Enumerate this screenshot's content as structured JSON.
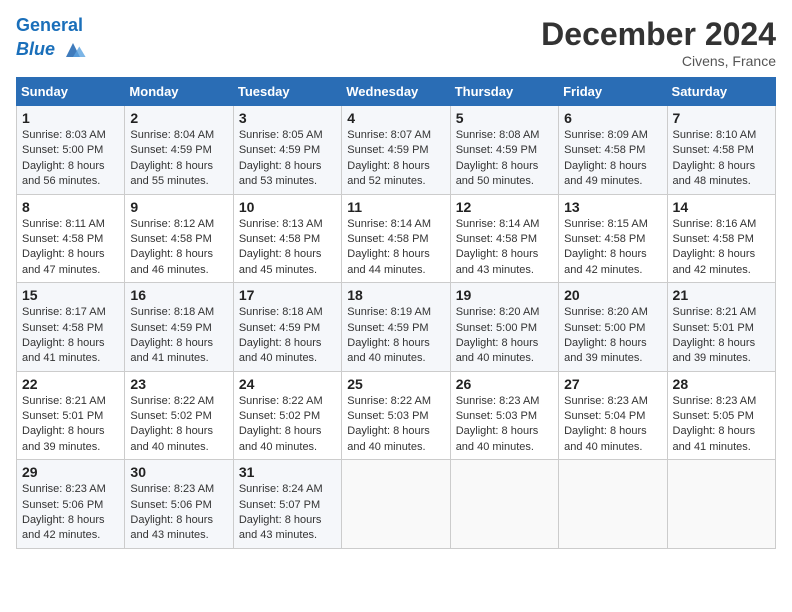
{
  "header": {
    "logo_line1": "General",
    "logo_line2": "Blue",
    "month_title": "December 2024",
    "location": "Civens, France"
  },
  "days_of_week": [
    "Sunday",
    "Monday",
    "Tuesday",
    "Wednesday",
    "Thursday",
    "Friday",
    "Saturday"
  ],
  "weeks": [
    [
      {
        "day": "1",
        "sunrise": "8:03 AM",
        "sunset": "5:00 PM",
        "daylight": "8 hours and 56 minutes."
      },
      {
        "day": "2",
        "sunrise": "8:04 AM",
        "sunset": "4:59 PM",
        "daylight": "8 hours and 55 minutes."
      },
      {
        "day": "3",
        "sunrise": "8:05 AM",
        "sunset": "4:59 PM",
        "daylight": "8 hours and 53 minutes."
      },
      {
        "day": "4",
        "sunrise": "8:07 AM",
        "sunset": "4:59 PM",
        "daylight": "8 hours and 52 minutes."
      },
      {
        "day": "5",
        "sunrise": "8:08 AM",
        "sunset": "4:59 PM",
        "daylight": "8 hours and 50 minutes."
      },
      {
        "day": "6",
        "sunrise": "8:09 AM",
        "sunset": "4:58 PM",
        "daylight": "8 hours and 49 minutes."
      },
      {
        "day": "7",
        "sunrise": "8:10 AM",
        "sunset": "4:58 PM",
        "daylight": "8 hours and 48 minutes."
      }
    ],
    [
      {
        "day": "8",
        "sunrise": "8:11 AM",
        "sunset": "4:58 PM",
        "daylight": "8 hours and 47 minutes."
      },
      {
        "day": "9",
        "sunrise": "8:12 AM",
        "sunset": "4:58 PM",
        "daylight": "8 hours and 46 minutes."
      },
      {
        "day": "10",
        "sunrise": "8:13 AM",
        "sunset": "4:58 PM",
        "daylight": "8 hours and 45 minutes."
      },
      {
        "day": "11",
        "sunrise": "8:14 AM",
        "sunset": "4:58 PM",
        "daylight": "8 hours and 44 minutes."
      },
      {
        "day": "12",
        "sunrise": "8:14 AM",
        "sunset": "4:58 PM",
        "daylight": "8 hours and 43 minutes."
      },
      {
        "day": "13",
        "sunrise": "8:15 AM",
        "sunset": "4:58 PM",
        "daylight": "8 hours and 42 minutes."
      },
      {
        "day": "14",
        "sunrise": "8:16 AM",
        "sunset": "4:58 PM",
        "daylight": "8 hours and 42 minutes."
      }
    ],
    [
      {
        "day": "15",
        "sunrise": "8:17 AM",
        "sunset": "4:58 PM",
        "daylight": "8 hours and 41 minutes."
      },
      {
        "day": "16",
        "sunrise": "8:18 AM",
        "sunset": "4:59 PM",
        "daylight": "8 hours and 41 minutes."
      },
      {
        "day": "17",
        "sunrise": "8:18 AM",
        "sunset": "4:59 PM",
        "daylight": "8 hours and 40 minutes."
      },
      {
        "day": "18",
        "sunrise": "8:19 AM",
        "sunset": "4:59 PM",
        "daylight": "8 hours and 40 minutes."
      },
      {
        "day": "19",
        "sunrise": "8:20 AM",
        "sunset": "5:00 PM",
        "daylight": "8 hours and 40 minutes."
      },
      {
        "day": "20",
        "sunrise": "8:20 AM",
        "sunset": "5:00 PM",
        "daylight": "8 hours and 39 minutes."
      },
      {
        "day": "21",
        "sunrise": "8:21 AM",
        "sunset": "5:01 PM",
        "daylight": "8 hours and 39 minutes."
      }
    ],
    [
      {
        "day": "22",
        "sunrise": "8:21 AM",
        "sunset": "5:01 PM",
        "daylight": "8 hours and 39 minutes."
      },
      {
        "day": "23",
        "sunrise": "8:22 AM",
        "sunset": "5:02 PM",
        "daylight": "8 hours and 40 minutes."
      },
      {
        "day": "24",
        "sunrise": "8:22 AM",
        "sunset": "5:02 PM",
        "daylight": "8 hours and 40 minutes."
      },
      {
        "day": "25",
        "sunrise": "8:22 AM",
        "sunset": "5:03 PM",
        "daylight": "8 hours and 40 minutes."
      },
      {
        "day": "26",
        "sunrise": "8:23 AM",
        "sunset": "5:03 PM",
        "daylight": "8 hours and 40 minutes."
      },
      {
        "day": "27",
        "sunrise": "8:23 AM",
        "sunset": "5:04 PM",
        "daylight": "8 hours and 40 minutes."
      },
      {
        "day": "28",
        "sunrise": "8:23 AM",
        "sunset": "5:05 PM",
        "daylight": "8 hours and 41 minutes."
      }
    ],
    [
      {
        "day": "29",
        "sunrise": "8:23 AM",
        "sunset": "5:06 PM",
        "daylight": "8 hours and 42 minutes."
      },
      {
        "day": "30",
        "sunrise": "8:23 AM",
        "sunset": "5:06 PM",
        "daylight": "8 hours and 43 minutes."
      },
      {
        "day": "31",
        "sunrise": "8:24 AM",
        "sunset": "5:07 PM",
        "daylight": "8 hours and 43 minutes."
      },
      null,
      null,
      null,
      null
    ]
  ]
}
